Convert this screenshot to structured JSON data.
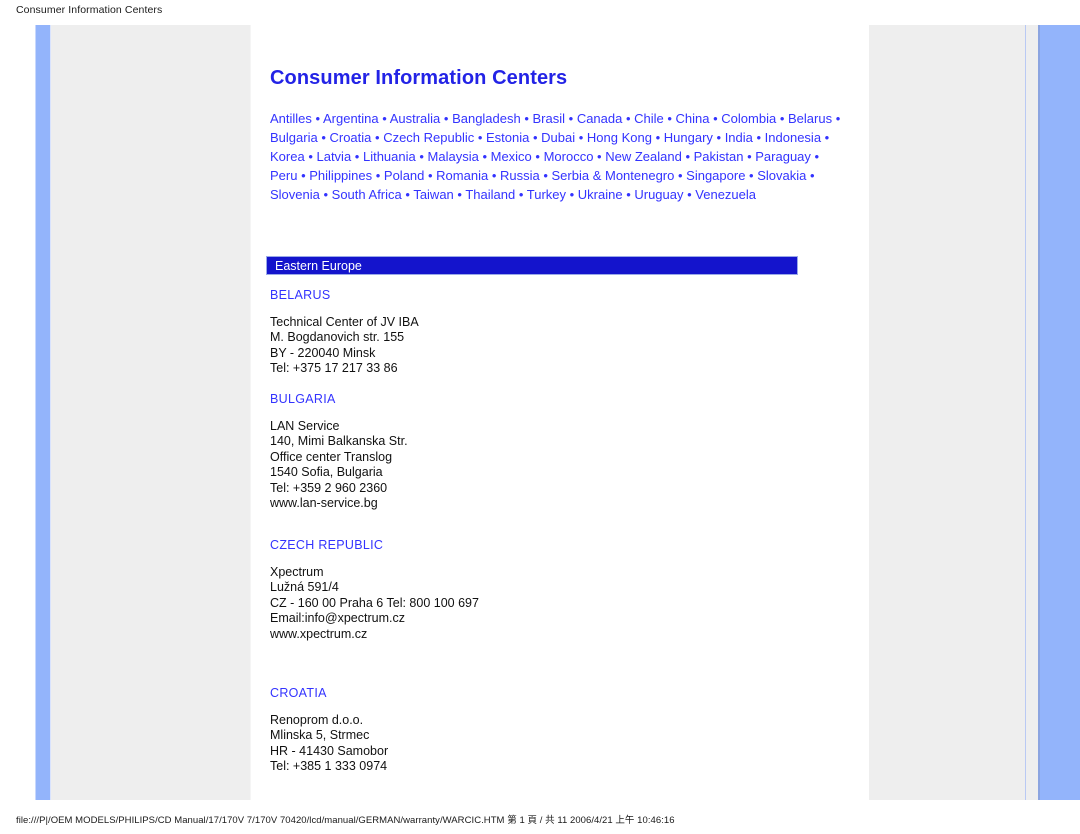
{
  "print": {
    "header_title": "Consumer Information Centers",
    "footer_path": "file:///P|/OEM MODELS/PHILIPS/CD Manual/17/170V 7/170V 70420/lcd/manual/GERMAN/warranty/WARCIC.HTM 第 1 頁 / 共 11 2006/4/21 上午 10:46:16"
  },
  "colors": {
    "link_blue": "#3333ff",
    "title_blue": "#2323e6",
    "banner_blue": "#1414cc",
    "rail_blue": "#93b4fb",
    "sheet_gray": "#eeeeee"
  },
  "page": {
    "title": "Consumer Information Centers",
    "separator": "•",
    "countries": [
      "Antilles",
      "Argentina",
      "Australia",
      "Bangladesh",
      "Brasil",
      "Canada",
      "Chile",
      "China",
      "Colombia",
      "Belarus",
      "Bulgaria",
      "Croatia",
      "Czech Republic",
      "Estonia",
      "Dubai",
      " Hong Kong",
      "Hungary",
      "India",
      "Indonesia",
      "Korea",
      "Latvia",
      "Lithuania",
      "Malaysia",
      "Mexico",
      "Morocco",
      "New Zealand",
      "Pakistan",
      "Paraguay",
      "Peru",
      "Philippines",
      "Poland",
      "Romania",
      "Russia",
      "Serbia & Montenegro",
      "Singapore",
      "Slovakia",
      "Slovenia",
      "South Africa",
      "Taiwan",
      "Thailand",
      "Turkey",
      "Ukraine",
      "Uruguay",
      "Venezuela"
    ]
  },
  "region": {
    "banner_label": "Eastern Europe",
    "sections": [
      {
        "heading": "BELARUS",
        "lines": [
          "Technical Center of JV IBA",
          "M. Bogdanovich str. 155",
          "BY - 220040 Minsk",
          "Tel: +375 17 217 33 86"
        ]
      },
      {
        "heading": "BULGARIA",
        "lines": [
          "LAN Service",
          "140, Mimi Balkanska Str.",
          "Office center Translog",
          "1540 Sofia, Bulgaria",
          "Tel: +359 2 960 2360",
          "www.lan-service.bg"
        ]
      },
      {
        "heading": "CZECH REPUBLIC",
        "lines": [
          "Xpectrum",
          "Lužná 591/4",
          "CZ - 160 00 Praha 6 Tel: 800 100 697",
          "Email:info@xpectrum.cz",
          "www.xpectrum.cz"
        ]
      },
      {
        "heading": "CROATIA",
        "lines": [
          "Renoprom d.o.o.",
          "Mlinska 5, Strmec",
          "HR - 41430 Samobor",
          "Tel: +385 1 333 0974"
        ]
      }
    ]
  }
}
